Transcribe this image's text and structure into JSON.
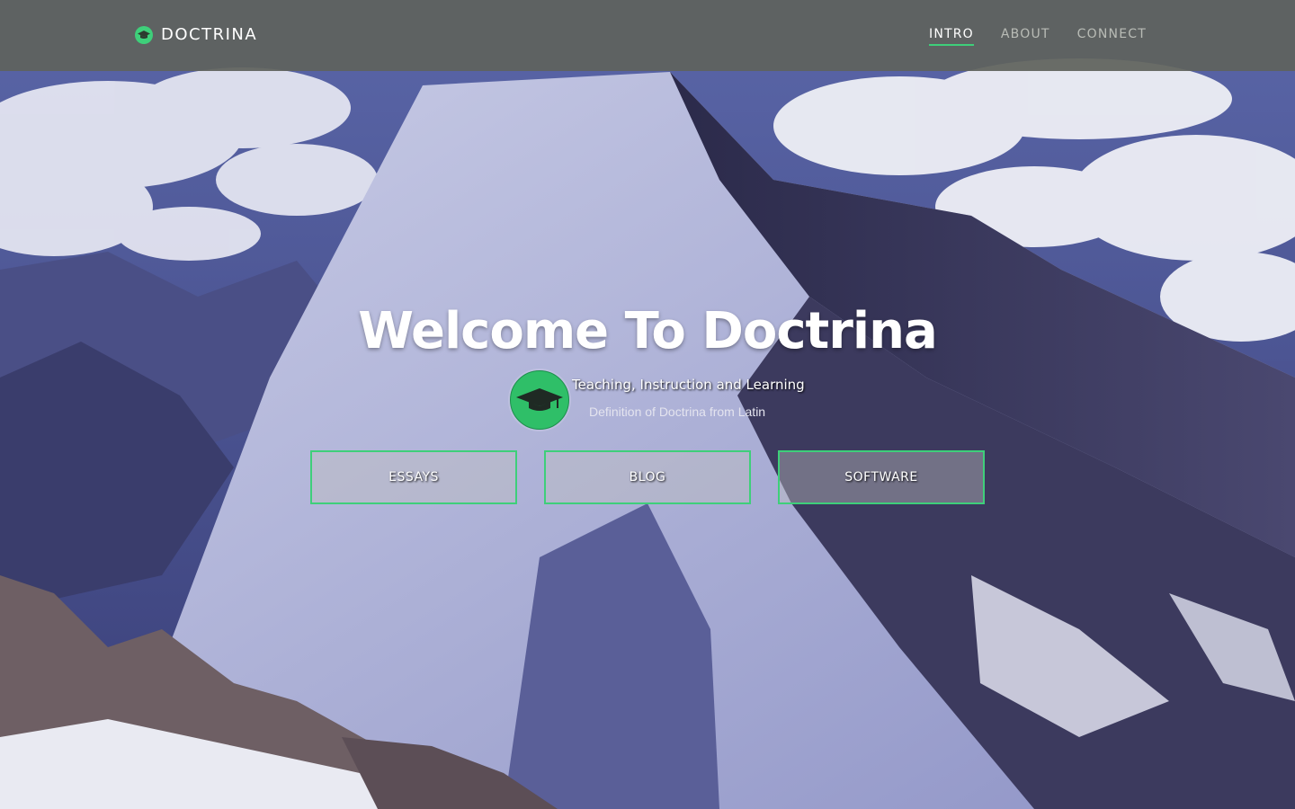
{
  "brand": {
    "name": "DOCTRINA",
    "icon": "graduation-cap-icon"
  },
  "nav": {
    "items": [
      {
        "label": "INTRO",
        "active": true
      },
      {
        "label": "ABOUT",
        "active": false
      },
      {
        "label": "CONNECT",
        "active": false
      }
    ]
  },
  "hero": {
    "title": "Welcome To Doctrina",
    "tagline": "Teaching, Instruction and Learning",
    "subtitle": "Definition of Doctrina from Latin",
    "badge_icon": "graduation-cap-icon",
    "buttons": [
      "ESSAYS",
      "BLOG",
      "SOFTWARE"
    ]
  },
  "colors": {
    "accent": "#3ecf7a",
    "navbar": "#5f625d"
  }
}
